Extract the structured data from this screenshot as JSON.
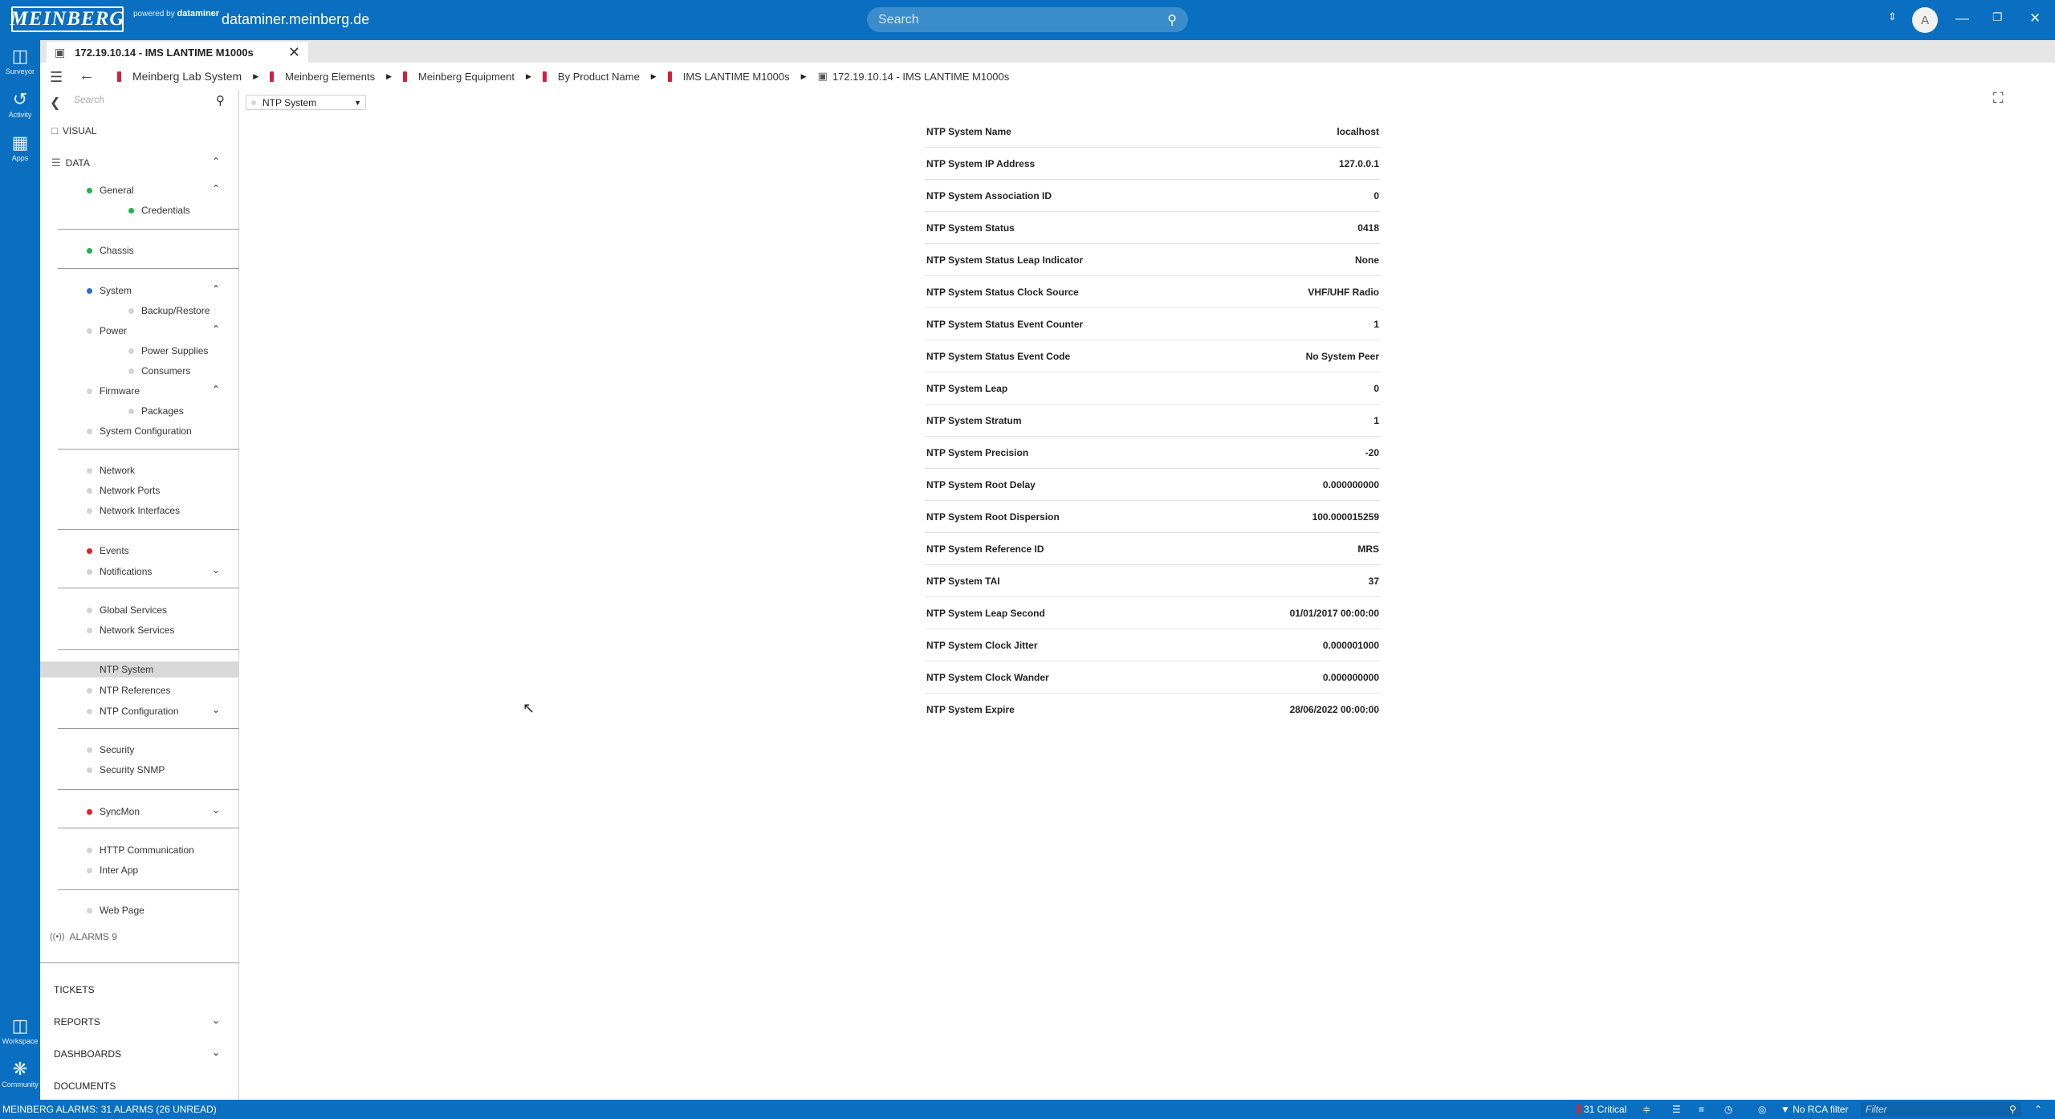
{
  "titlebar": {
    "logo": "MEINBERG",
    "powered_by": "powered by",
    "powered_brand": "dataminer",
    "host": "dataminer.meinberg.de",
    "search_placeholder": "Search",
    "avatar_initial": "A"
  },
  "rail": {
    "items": [
      {
        "label": "Surveyor",
        "icon": "surveyor-icon"
      },
      {
        "label": "Activity",
        "icon": "history-icon"
      },
      {
        "label": "Apps",
        "icon": "apps-icon"
      },
      {
        "label": "Workspace",
        "icon": "workspace-icon"
      },
      {
        "label": "Community",
        "icon": "community-icon"
      }
    ]
  },
  "tab": {
    "title": "172.19.10.14 - IMS LANTIME M1000s"
  },
  "breadcrumb": [
    "Meinberg Lab System",
    "Meinberg Elements",
    "Meinberg Equipment",
    "By Product Name",
    "IMS LANTIME M1000s",
    "172.19.10.14 - IMS LANTIME M1000s"
  ],
  "nav": {
    "search_placeholder": "Search",
    "visual": "VISUAL",
    "data": "DATA",
    "items": {
      "general": "General",
      "credentials": "Credentials",
      "chassis": "Chassis",
      "system": "System",
      "backup": "Backup/Restore",
      "power": "Power",
      "power_supplies": "Power Supplies",
      "consumers": "Consumers",
      "firmware": "Firmware",
      "packages": "Packages",
      "system_config": "System Configuration",
      "network": "Network",
      "network_ports": "Network Ports",
      "network_interfaces": "Network Interfaces",
      "events": "Events",
      "notifications": "Notifications",
      "global_services": "Global Services",
      "network_services": "Network Services",
      "ntp_system": "NTP System",
      "ntp_references": "NTP References",
      "ntp_configuration": "NTP Configuration",
      "security": "Security",
      "security_snmp": "Security SNMP",
      "syncmon": "SyncMon",
      "http_comm": "HTTP Communication",
      "inter_app": "Inter App",
      "web_page": "Web Page"
    },
    "alarms_label": "ALARMS",
    "alarms_count": "9",
    "tickets": "TICKETS",
    "reports": "REPORTS",
    "dashboards": "DASHBOARDS",
    "documents": "DOCUMENTS"
  },
  "content": {
    "page_selector": "NTP System",
    "params": [
      {
        "name": "NTP System Name",
        "value": "localhost"
      },
      {
        "name": "NTP System IP Address",
        "value": "127.0.0.1"
      },
      {
        "name": "NTP System Association ID",
        "value": "0"
      },
      {
        "name": "NTP System Status",
        "value": "0418"
      },
      {
        "name": "NTP System Status Leap Indicator",
        "value": "None"
      },
      {
        "name": "NTP System Status Clock Source",
        "value": "VHF/UHF Radio"
      },
      {
        "name": "NTP System Status Event Counter",
        "value": "1"
      },
      {
        "name": "NTP System Status Event Code",
        "value": "No System Peer"
      },
      {
        "name": "NTP System Leap",
        "value": "0"
      },
      {
        "name": "NTP System Stratum",
        "value": "1"
      },
      {
        "name": "NTP System Precision",
        "value": "-20"
      },
      {
        "name": "NTP System Root Delay",
        "value": "0.000000000"
      },
      {
        "name": "NTP System Root Dispersion",
        "value": "100.000015259"
      },
      {
        "name": "NTP System Reference ID",
        "value": "MRS"
      },
      {
        "name": "NTP System TAI",
        "value": "37"
      },
      {
        "name": "NTP System Leap Second",
        "value": "01/01/2017 00:00:00"
      },
      {
        "name": "NTP System Clock Jitter",
        "value": "0.000001000"
      },
      {
        "name": "NTP System Clock Wander",
        "value": "0.000000000"
      },
      {
        "name": "NTP System Expire",
        "value": "28/06/2022 00:00:00"
      }
    ]
  },
  "statusbar": {
    "summary": "MEINBERG ALARMS: 31 ALARMS (26 UNREAD)",
    "critical": "31 Critical",
    "rca": "No RCA filter",
    "filter_placeholder": "Filter"
  },
  "colors": {
    "brand_blue": "#0a6fc0",
    "status_green": "#22b14c",
    "status_blue": "#2e6bd3",
    "status_red": "#e0202b",
    "status_gray": "#d3d3d3"
  }
}
